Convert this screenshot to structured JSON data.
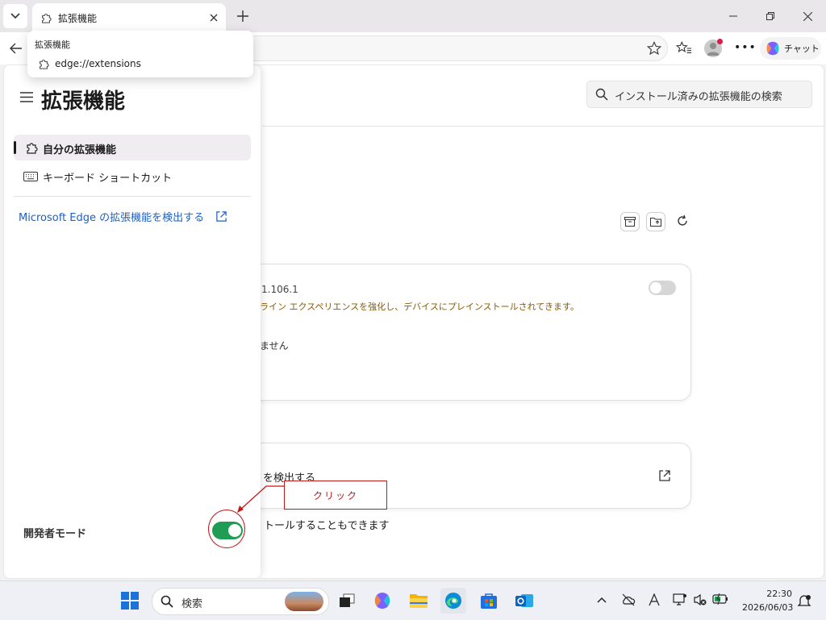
{
  "tab": {
    "title": "拡張機能"
  },
  "dropdown": {
    "title": "拡張機能",
    "url": "edge://extensions"
  },
  "toolbar": {
    "chat_label": "チャット"
  },
  "search": {
    "placeholder": "インストール済みの拡張機能の検索"
  },
  "sidebar": {
    "title": "拡張機能",
    "nav": [
      {
        "label": "自分の拡張機能",
        "icon": "puzzle-icon",
        "selected": true
      },
      {
        "label": "キーボード ショートカット",
        "icon": "keyboard-icon",
        "selected": false
      }
    ],
    "discover_link": "Microsoft Edge の拡張機能を検出する",
    "developer_mode_label": "開発者モード",
    "developer_mode_on": true
  },
  "extension_card": {
    "version": "1.106.1",
    "description": "ライン エクスペリエンスを強化し、デバイスにプレインストールされてきます。",
    "status": "ません",
    "enabled": false
  },
  "discover_card": {
    "text": "を検出する"
  },
  "store_text": "トールすることもできます",
  "annotation": {
    "label": "クリック"
  },
  "taskbar": {
    "search_label": "検索",
    "time": "22:30",
    "date": "2026/06/03"
  },
  "colors": {
    "accent_green": "#1f9d55",
    "annotation_red": "#c21818",
    "link_blue": "#1f5fbf"
  }
}
